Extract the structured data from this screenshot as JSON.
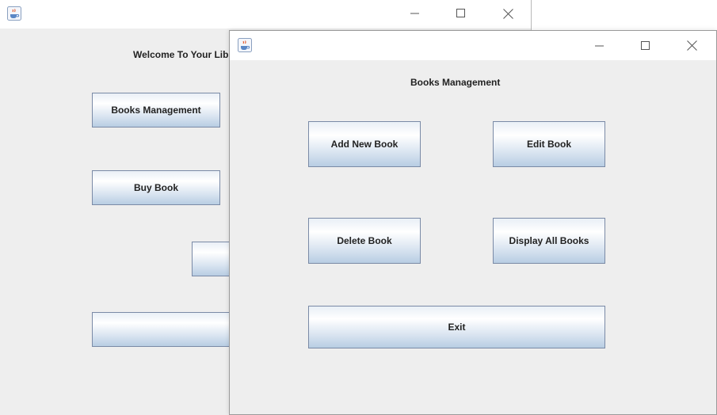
{
  "main_window": {
    "heading": "Welcome To Your Libr",
    "buttons": {
      "books_management": "Books Management",
      "buy_book": "Buy Book",
      "hidden_button": "",
      "bottom_button": ""
    }
  },
  "books_window": {
    "heading": "Books Management",
    "buttons": {
      "add": "Add New Book",
      "edit": "Edit Book",
      "delete": "Delete Book",
      "display": "Display All Books",
      "exit": "Exit"
    }
  },
  "icons": {
    "app": "java-coffee-cup-icon",
    "minimize": "minimize-icon",
    "maximize": "maximize-icon",
    "close": "close-icon"
  },
  "colors": {
    "window_bg": "#eeeeee",
    "titlebar_bg": "#ffffff",
    "button_border": "#7a8aa6",
    "button_gradient_bottom": "#b8cde3"
  }
}
